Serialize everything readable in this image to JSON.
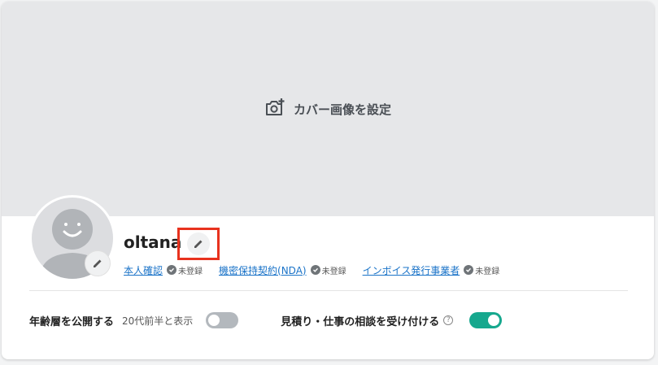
{
  "cover": {
    "label": "カバー画像を設定",
    "icon": "add-photo-icon"
  },
  "profile": {
    "username": "oltana",
    "avatar_icon": "smiley-avatar-icon",
    "edit_icon": "pencil-icon",
    "highlight_color": "#e8321e"
  },
  "verifications": [
    {
      "label": "本人確認",
      "status": "未登録"
    },
    {
      "label": "機密保持契約(NDA)",
      "status": "未登録"
    },
    {
      "label": "インボイス発行事業者",
      "status": "未登録"
    }
  ],
  "settings": {
    "age": {
      "label": "年齢層を公開する",
      "sub": "20代前半と表示",
      "enabled": false
    },
    "consult": {
      "label": "見積り・仕事の相談を受け付ける",
      "help": "?",
      "enabled": true
    }
  },
  "colors": {
    "link": "#1a73c8",
    "toggle_on": "#16a88e",
    "toggle_off": "#b3b8bd"
  }
}
